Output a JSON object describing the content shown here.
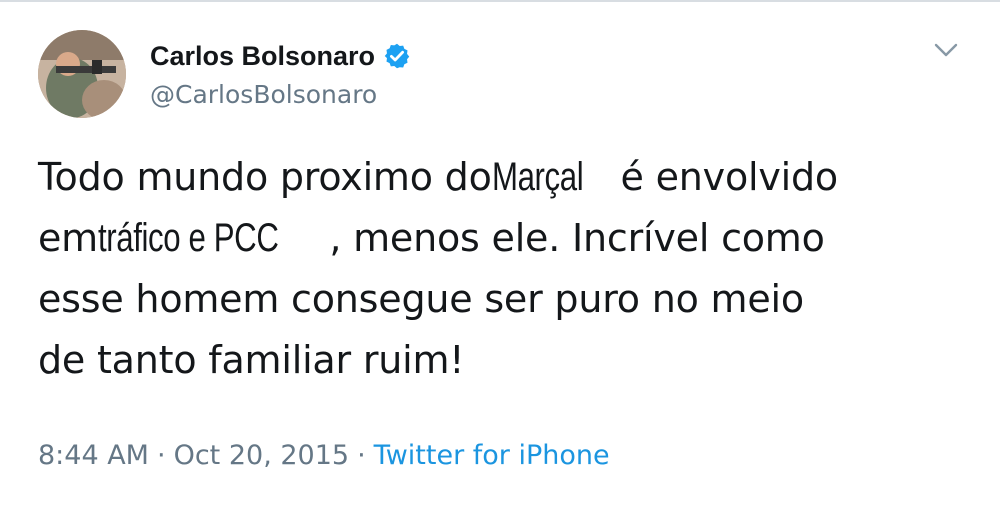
{
  "tweet": {
    "display_name": "Carlos Bolsonaro",
    "handle": "@CarlosBolsonaro",
    "text": {
      "line1_a": "Todo mundo proximo do",
      "line1_b": "Marçal",
      "line1_c": " é envolvido",
      "line2_a": "em",
      "line2_b": " tráfico e PCC",
      "line2_c": ", menos ele. Incrível como",
      "line3": "esse homem consegue ser puro no meio",
      "line4": "de tanto familiar ruim!"
    },
    "time": "8:44 AM",
    "separator": "·",
    "date": "Oct 20, 2015",
    "source": "Twitter for iPhone"
  },
  "icons": {
    "verified": "verified-badge-icon",
    "menu": "chevron-down-icon"
  },
  "colors": {
    "text_primary": "#14171a",
    "text_secondary": "#657786",
    "link": "#1b95e0",
    "verified": "#1da1f2"
  }
}
